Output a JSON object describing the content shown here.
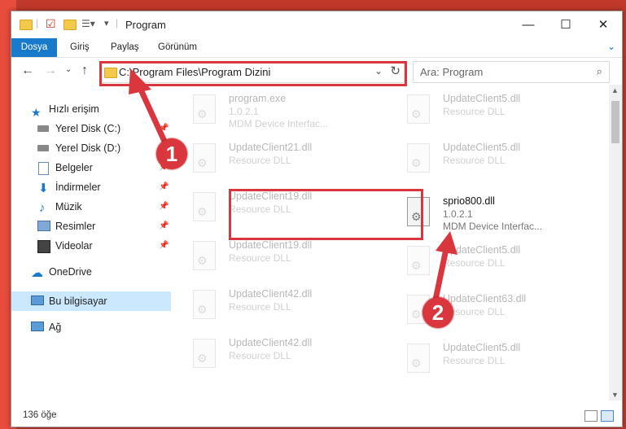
{
  "window": {
    "title": "Program",
    "controls": {
      "minimize": "—",
      "maximize": "☐",
      "close": "✕"
    }
  },
  "ribbon": {
    "tabs": [
      "Dosya",
      "Giriş",
      "Paylaş",
      "Görünüm"
    ]
  },
  "address": {
    "path": "C:\\Program Files\\Program Dizini",
    "search_placeholder": "Ara: Program"
  },
  "sidebar": {
    "quick_access": "Hızlı erişim",
    "items": [
      {
        "label": "Yerel Disk (C:)",
        "pinned": true
      },
      {
        "label": "Yerel Disk (D:)",
        "pinned": false
      },
      {
        "label": "Belgeler",
        "pinned": true
      },
      {
        "label": "İndirmeler",
        "pinned": true
      },
      {
        "label": "Müzik",
        "pinned": true
      },
      {
        "label": "Resimler",
        "pinned": true
      },
      {
        "label": "Videolar",
        "pinned": true
      }
    ],
    "onedrive": "OneDrive",
    "this_pc": "Bu bilgisayar",
    "network": "Ağ"
  },
  "files": {
    "left": [
      {
        "name": "program.exe",
        "line2": "1.0.2.1",
        "line3": "MDM Device Interfac..."
      },
      {
        "name": "UpdateClient21.dll",
        "line2": "Resource DLL"
      },
      {
        "name": "UpdateClient19.dll",
        "line2": "Resource DLL"
      },
      {
        "name": "UpdateClient19.dll",
        "line2": "Resource DLL"
      },
      {
        "name": "UpdateClient42.dll",
        "line2": "Resource DLL"
      },
      {
        "name": "UpdateClient42.dll",
        "line2": "Resource DLL"
      }
    ],
    "right": [
      {
        "name": "UpdateClient5.dll",
        "line2": "Resource DLL"
      },
      {
        "name": "UpdateClient5.dll",
        "line2": "Resource DLL"
      },
      {
        "name": "sprio800.dll",
        "line2": "1.0.2.1",
        "line3": "MDM Device Interfac..."
      },
      {
        "name": "UpdateClient5.dll",
        "line2": "Resource DLL"
      },
      {
        "name": "UpdateClient63.dll",
        "line2": "Resource DLL"
      },
      {
        "name": "UpdateClient5.dll",
        "line2": "Resource DLL"
      }
    ]
  },
  "status": {
    "count": "136 öğe"
  },
  "callouts": [
    "1",
    "2"
  ],
  "colors": {
    "accent": "#1979ca",
    "highlight": "#d9363e",
    "selection": "#cce8ff"
  }
}
